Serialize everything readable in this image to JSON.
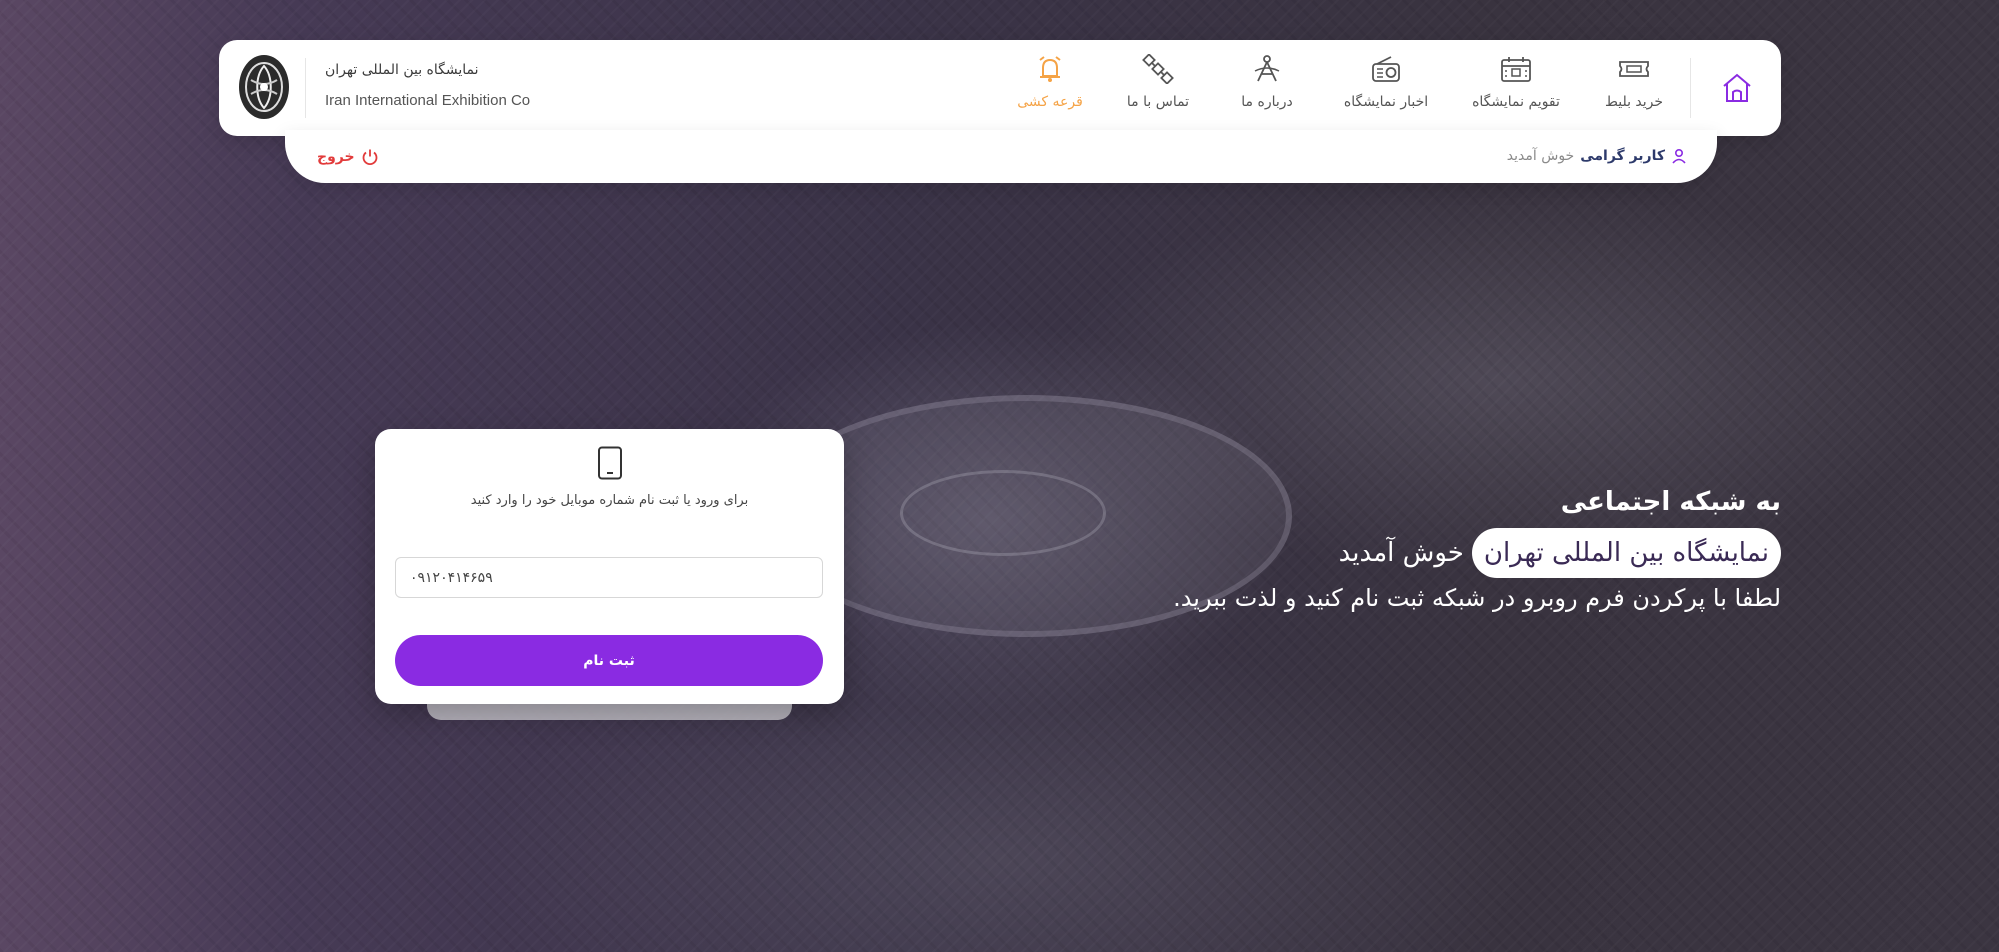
{
  "brand": {
    "name_fa": "نمایشگاه بین المللی تهران",
    "name_en": "Iran International Exhibition Co",
    "logo_icon": "exhibition-emblem-icon"
  },
  "nav": {
    "home_icon": "home-icon",
    "items": [
      {
        "label": "خرید بلیط",
        "icon": "ticket-icon"
      },
      {
        "label": "تقویم نمایشگاه",
        "icon": "calendar-icon"
      },
      {
        "label": "اخبار نمایشگاه",
        "icon": "radio-icon"
      },
      {
        "label": "درباره ما",
        "icon": "compass-icon"
      },
      {
        "label": "تماس با ما",
        "icon": "satellite-icon"
      },
      {
        "label": "قرعه کشی",
        "icon": "alarm-bell-icon",
        "active": true
      }
    ]
  },
  "userbar": {
    "user_title": "کاربر گرامی",
    "greeting": "خوش آمدید",
    "logout_label": "خروج"
  },
  "login": {
    "hint": "برای ورود یا ثبت نام شماره موبایل خود را وارد کنید",
    "phone_value": "۰۹۱۲۰۴۱۴۶۵۹",
    "submit_label": "ثبت نام"
  },
  "hero": {
    "line1": "به شبکه اجتماعی",
    "pill": "نمایشگاه بین المللی تهران",
    "line2_suffix": "خوش آمدید",
    "line3": "لطفا با پرکردن فرم روبرو در شبکه ثبت نام کنید و لذت ببرید."
  },
  "colors": {
    "accent": "#8a2be2",
    "active_nav": "#f5a346",
    "logout": "#e23b3b",
    "user_title": "#2d3a6b"
  }
}
